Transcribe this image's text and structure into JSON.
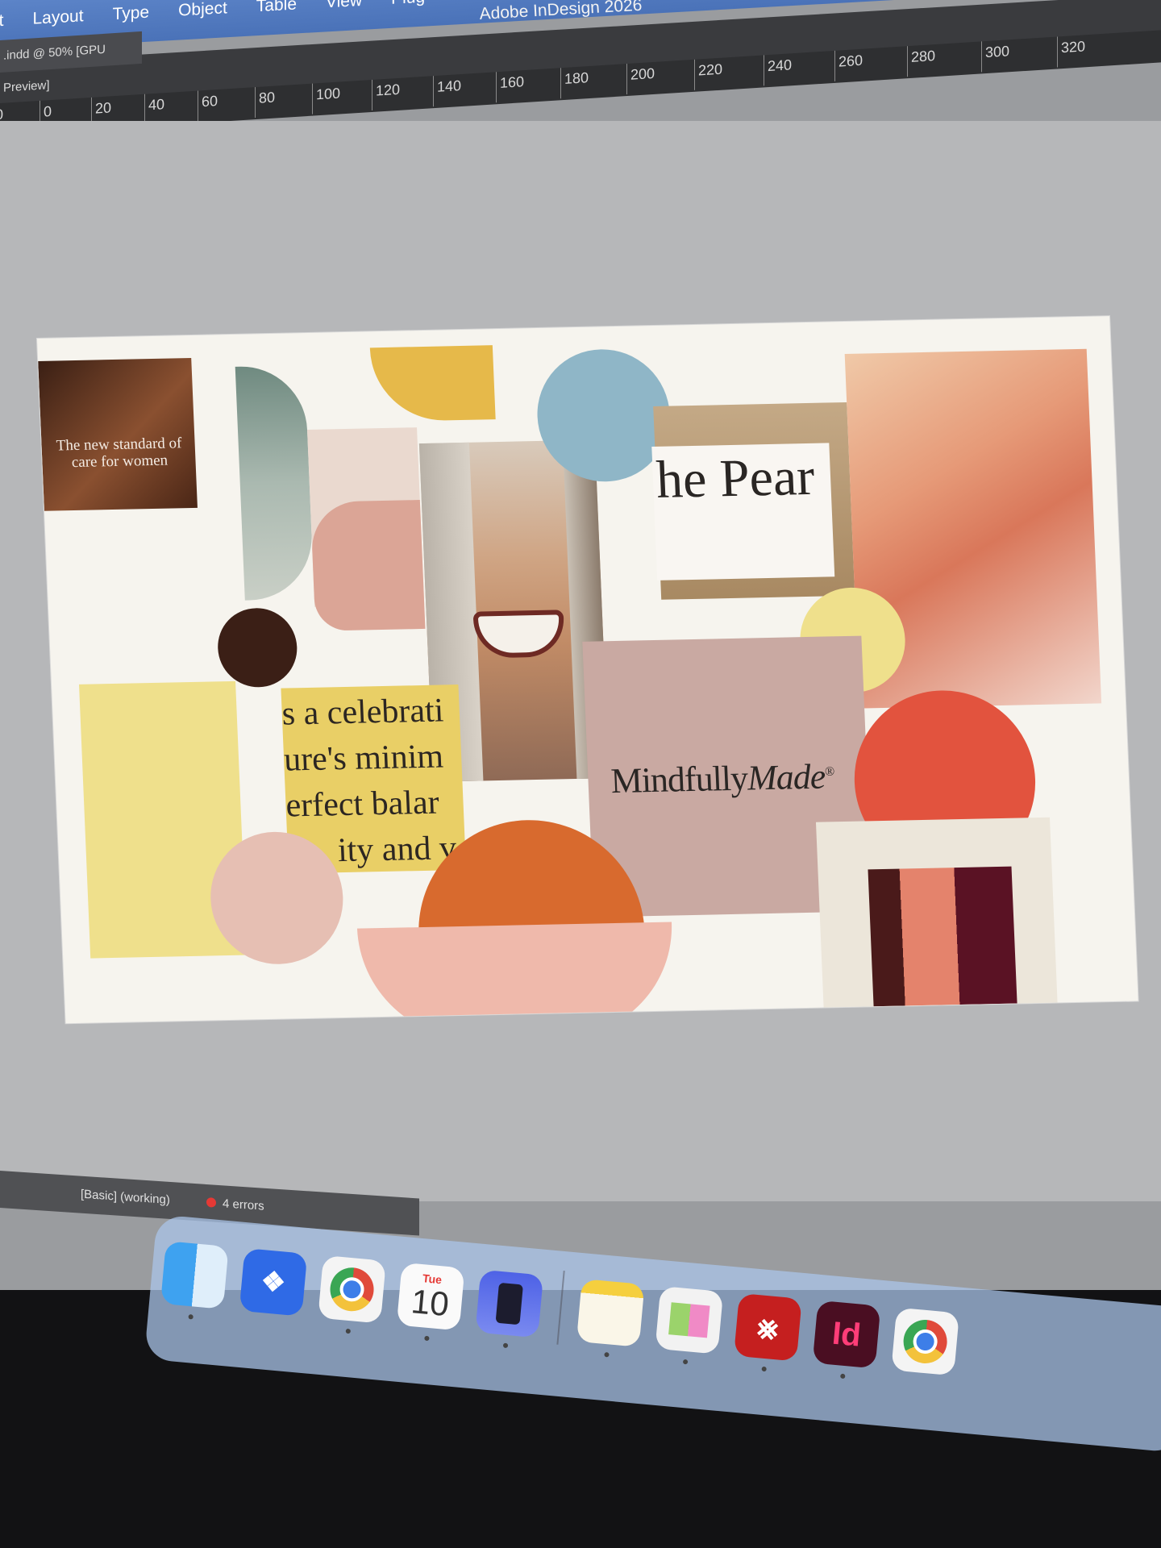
{
  "app": {
    "title": "Adobe InDesign 2026"
  },
  "menu": [
    "it",
    "Layout",
    "Type",
    "Object",
    "Table",
    "View",
    "Plug"
  ],
  "document": {
    "tab": ".indd @ 50% [GPU Preview]"
  },
  "ruler_ticks": [
    "0",
    "0",
    "20",
    "40",
    "60",
    "80",
    "100",
    "120",
    "140",
    "160",
    "180",
    "200",
    "220",
    "240",
    "260",
    "280",
    "300",
    "320"
  ],
  "canvas": {
    "tile_text": "The new standard of care for women",
    "headline": "The Pear",
    "headline_visible": "he Pear",
    "brand_left": "Mindfully",
    "brand_right": "Made",
    "registered": "®",
    "copy_lines": [
      "s a celebrati",
      "ure's minim",
      "erfect balar",
      "ity and v"
    ]
  },
  "status": {
    "workspace": "[Basic] (working)",
    "errors": "4 errors"
  },
  "dock": {
    "calendar_day": "Tue",
    "calendar_date": "10",
    "indesign_label": "Id",
    "items": [
      "finder-icon",
      "dropbox-icon",
      "chrome-icon",
      "calendar-icon",
      "simulator-icon",
      "notes-icon",
      "stickies-icon",
      "acrobat-icon",
      "indesign-icon",
      "chrome-icon"
    ]
  },
  "colors": {
    "menubar": "#4a72b8",
    "page": "#f6f4ee",
    "mustard": "#e6b94a",
    "sky": "#8fb6c7",
    "cocoa": "#3b1f16",
    "butter": "#efe08c",
    "blush": "#e6bfb3",
    "rose": "#c9a9a2",
    "coral": "#e2533e",
    "rust": "#d86a2e",
    "error": "#e53935"
  }
}
